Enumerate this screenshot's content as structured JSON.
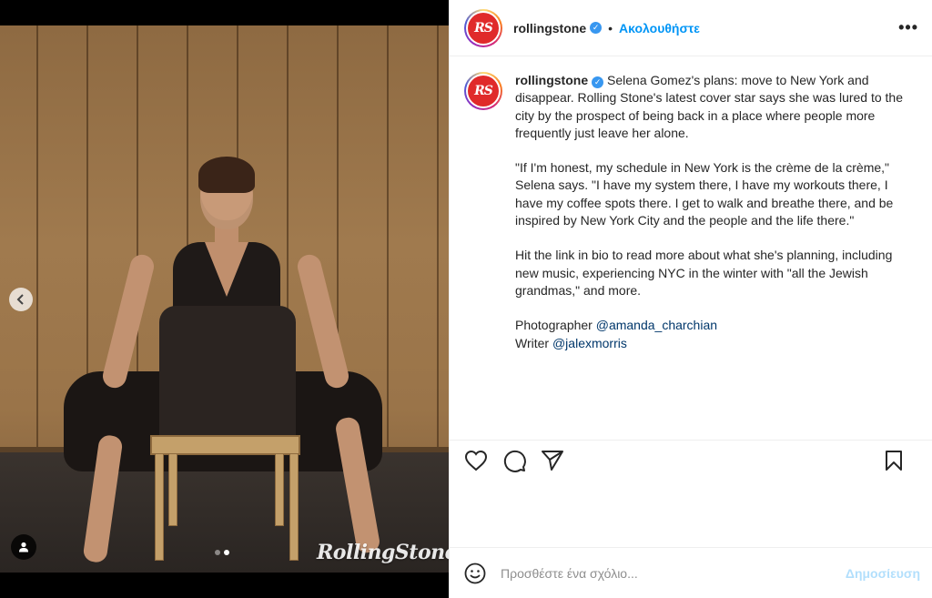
{
  "media": {
    "watermark": "RollingStone",
    "carousel": {
      "count": 2,
      "active_index": 1
    },
    "prev_icon": "chevron-left-icon",
    "tag_icon": "user-tag-icon"
  },
  "header": {
    "avatar_text": "RS",
    "username": "rollingstone",
    "separator": "•",
    "follow_label": "Ακολουθήστε",
    "more_label": "•••"
  },
  "caption": {
    "avatar_text": "RS",
    "username": "rollingstone",
    "paragraph1": "Selena Gomez's plans: move to New York and disappear. Rolling Stone's latest cover star says she was lured to the city by the prospect of being back in a place where people more frequently just leave her alone.",
    "paragraph2": "\"If I'm honest, my schedule in New York is the crème de la crème,\" Selena says. \"I have my system there, I have my workouts there, I have my coffee spots there. I get to walk and breathe there, and be inspired by New York City and the people and the life there.\"",
    "paragraph3": "Hit the link in bio to read more about what she's planning, including new music, experiencing NYC in the winter with \"all the Jewish grandmas,\" and more.",
    "photographer_label": "Photographer",
    "photographer_handle": "@amanda_charchian",
    "writer_label": "Writer",
    "writer_handle": "@jalexmorris"
  },
  "actions": {
    "like_icon": "heart-icon",
    "comment_icon": "comment-icon",
    "share_icon": "paper-plane-icon",
    "save_icon": "bookmark-icon"
  },
  "comment": {
    "emoji_icon": "smiley-icon",
    "placeholder": "Προσθέστε ένα σχόλιο...",
    "post_label": "Δημοσίευση"
  },
  "colors": {
    "accent": "#0095f6",
    "post_disabled": "#b2dffc",
    "brand_red": "#e02a2a",
    "verified": "#3897f0"
  }
}
